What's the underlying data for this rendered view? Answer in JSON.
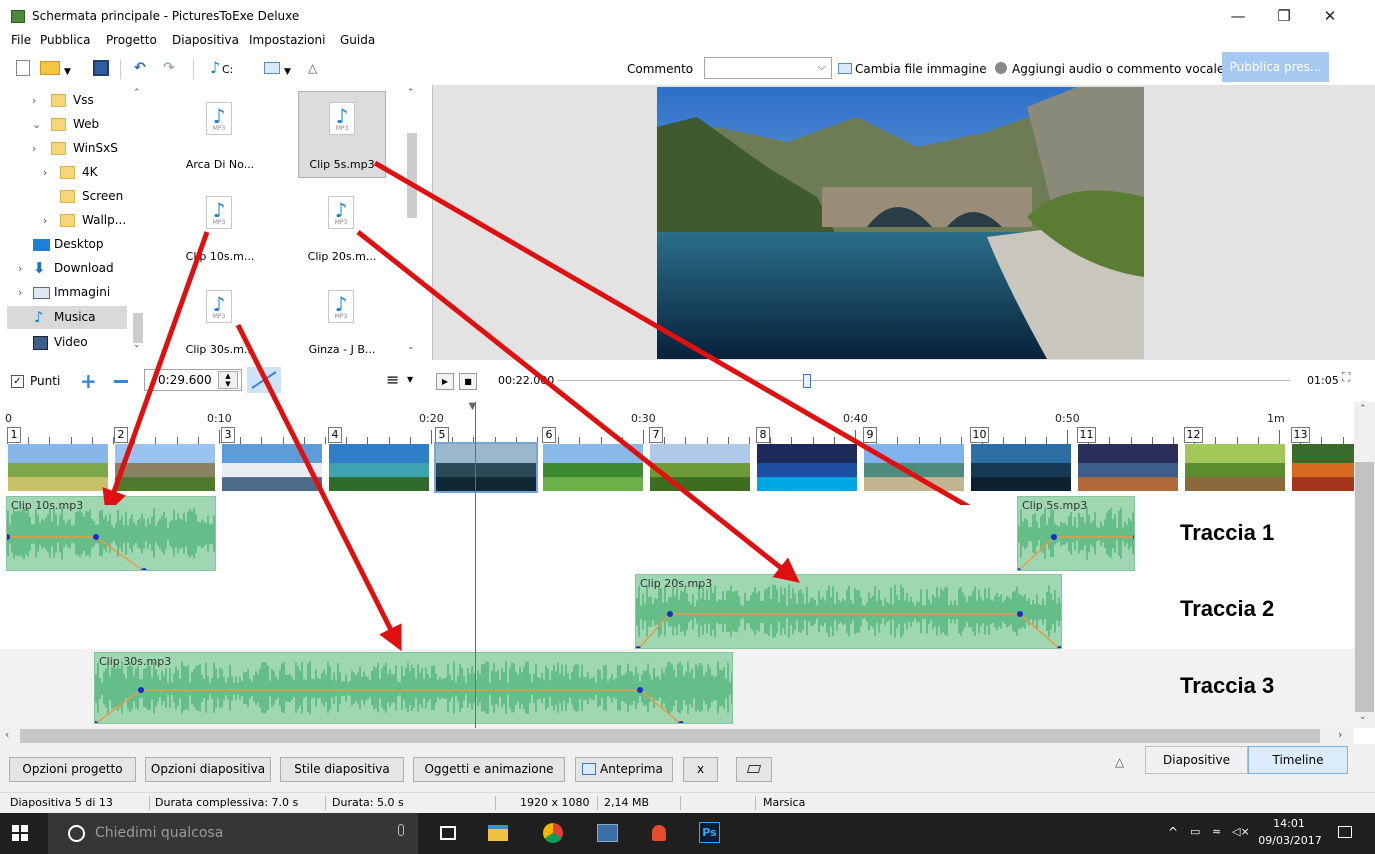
{
  "window": {
    "title": "Schermata principale - PicturesToExe Deluxe",
    "minimize_glyph": "—",
    "maximize_glyph": "❐",
    "close_glyph": "✕"
  },
  "menu": {
    "items": [
      "File",
      "Pubblica",
      "Progetto",
      "Diapositiva",
      "Impostazioni",
      "Guida"
    ]
  },
  "toolbar": {
    "drive_label": "C:",
    "comment_label": "Commento",
    "comment_value": "",
    "change_image_label": "Cambia file immagine",
    "add_audio_label": "Aggiungi audio o commento vocale",
    "publish_label": "Pubblica pres...",
    "icons": [
      "new-document-icon",
      "open-folder-icon",
      "save-icon",
      "undo-icon",
      "redo-icon",
      "music-note-icon",
      "image-list-icon",
      "triangle-icon"
    ]
  },
  "folder_tree": {
    "items": [
      {
        "label": "Vss",
        "expandable": true
      },
      {
        "label": "Web",
        "expandable": true
      },
      {
        "label": "WinSxS",
        "expandable": true
      },
      {
        "label": "4K",
        "expandable": true
      },
      {
        "label": "Screen",
        "expandable": false
      },
      {
        "label": "Wallp...",
        "expandable": true
      },
      {
        "label": "Desktop",
        "expandable": false
      },
      {
        "label": "Download",
        "expandable": true
      },
      {
        "label": "Immagini",
        "expandable": true
      },
      {
        "label": "Musica",
        "expandable": false
      },
      {
        "label": "Video",
        "expandable": true
      }
    ],
    "selected": "Musica"
  },
  "files": {
    "badge": "MP3",
    "items": [
      "Arca Di No...",
      "Clip 5s.mp3",
      "Clip 10s.m...",
      "Clip 20s.m...",
      "Clip 30s.m...",
      "Ginza - J B..."
    ],
    "selected": "Clip 5s.mp3"
  },
  "controls": {
    "punti_label": "Punti",
    "punti_checked": true,
    "check_glyph": "✓",
    "duration_value": "0:29.600",
    "current_time": "00:22.000",
    "total_time": "01:05",
    "playhead_position": 0.338
  },
  "timeline": {
    "ruler_labels": [
      "0",
      "0:10",
      "0:20",
      "0:30",
      "0:40",
      "0:50",
      "1m"
    ],
    "slides": [
      "1",
      "2",
      "3",
      "4",
      "5",
      "6",
      "7",
      "8",
      "9",
      "10",
      "11",
      "12",
      "13"
    ],
    "selected_slide": "5",
    "tracks": [
      {
        "label": "Traccia 1",
        "clips": [
          "Clip 10s.mp3",
          "Clip 5s.mp3"
        ]
      },
      {
        "label": "Traccia 2",
        "clips": [
          "Clip 20s.mp3"
        ]
      },
      {
        "label": "Traccia 3",
        "clips": [
          "Clip 30s.mp3"
        ]
      }
    ]
  },
  "bottom_buttons": {
    "project_options": "Opzioni progetto",
    "slide_options": "Opzioni diapositiva",
    "slide_style": "Stile diapositiva",
    "objects_animation": "Oggetti e animazione",
    "preview": "Anteprima",
    "close_x": "x"
  },
  "view_tabs": {
    "slides": "Diapositive",
    "timeline": "Timeline",
    "active": "Timeline"
  },
  "status": {
    "slide": "Diapositiva 5 di 13",
    "total_duration": "Durata complessiva: 7.0 s",
    "duration": "Durata: 5.0 s",
    "resolution": "1920 x 1080",
    "size": "2,14 MB",
    "name": "Marsica"
  },
  "taskbar": {
    "search_placeholder": "Chiedimi qualcosa",
    "time": "14:01",
    "date": "09/03/2017",
    "apps": [
      "windows-start-icon",
      "microphone-icon",
      "task-view-icon",
      "file-explorer-icon",
      "chrome-icon",
      "photos-icon",
      "pictures-to-exe-icon",
      "photoshop-icon"
    ],
    "photoshop_label": "Ps"
  },
  "colors": {
    "clip_fill": "#9fd7b2",
    "waveform": "#3fae6e",
    "envelope": "#e89a4a",
    "envelope_point": "#1530c8",
    "arrow": "#e01010",
    "accent": "#a7c8f0"
  }
}
